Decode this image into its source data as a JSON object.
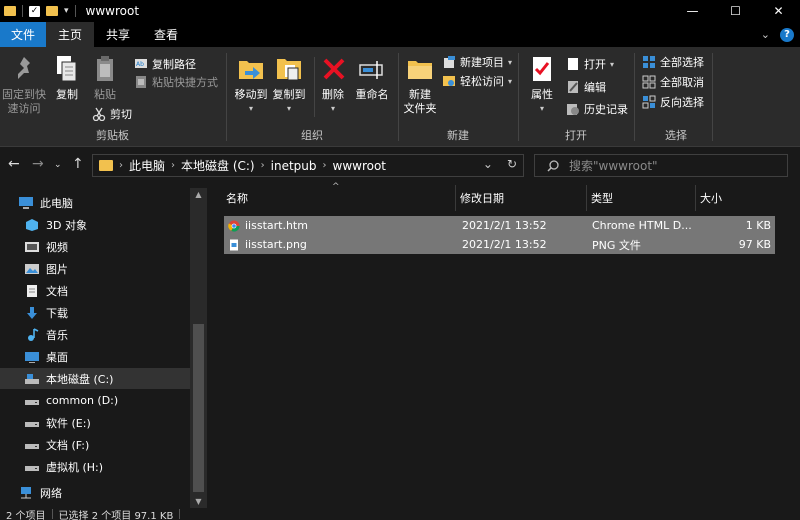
{
  "window": {
    "title": "wwwroot",
    "controls": [
      "—",
      "☐",
      "✕"
    ]
  },
  "ribbon_tabs": [
    "文件",
    "主页",
    "共享",
    "查看"
  ],
  "ribbon": {
    "clipboard": {
      "label": "剪贴板",
      "pin": "固定到快速访问",
      "pin_line1": "固定到快",
      "pin_line2": "速访问",
      "copy": "复制",
      "paste": "粘贴",
      "copy_path": "复制路径",
      "paste_shortcut": "粘贴快捷方式",
      "cut": "剪切"
    },
    "organize": {
      "label": "组织",
      "move_to": "移动到",
      "copy_to": "复制到",
      "delete": "删除",
      "rename": "重命名"
    },
    "new": {
      "label": "新建",
      "new_folder_line1": "新建",
      "new_folder_line2": "文件夹",
      "new_item": "新建项目",
      "easy_access": "轻松访问"
    },
    "open": {
      "label": "打开",
      "properties": "属性",
      "open": "打开",
      "edit": "编辑",
      "history": "历史记录"
    },
    "select": {
      "label": "选择",
      "select_all": "全部选择",
      "select_none": "全部取消",
      "invert": "反向选择"
    }
  },
  "address": {
    "crumbs": [
      "此电脑",
      "本地磁盘 (C:)",
      "inetpub",
      "wwwroot"
    ],
    "search_placeholder": "搜索\"wwwroot\""
  },
  "nav": [
    {
      "label": "此电脑",
      "icon": "computer-icon",
      "selected": false
    },
    {
      "label": "3D 对象",
      "icon": "3d-objects-icon",
      "selected": false
    },
    {
      "label": "视频",
      "icon": "videos-icon",
      "selected": false
    },
    {
      "label": "图片",
      "icon": "pictures-icon",
      "selected": false
    },
    {
      "label": "文档",
      "icon": "documents-icon",
      "selected": false
    },
    {
      "label": "下载",
      "icon": "downloads-icon",
      "selected": false
    },
    {
      "label": "音乐",
      "icon": "music-icon",
      "selected": false
    },
    {
      "label": "桌面",
      "icon": "desktop-icon",
      "selected": false
    },
    {
      "label": "本地磁盘 (C:)",
      "icon": "drive-c-icon",
      "selected": true
    },
    {
      "label": "common (D:)",
      "icon": "drive-icon",
      "selected": false
    },
    {
      "label": "软件 (E:)",
      "icon": "drive-icon",
      "selected": false
    },
    {
      "label": "文档 (F:)",
      "icon": "drive-icon",
      "selected": false
    },
    {
      "label": "虚拟机 (H:)",
      "icon": "drive-icon",
      "selected": false
    },
    {
      "label": "网络",
      "icon": "network-icon",
      "selected": false
    }
  ],
  "columns": [
    "名称",
    "修改日期",
    "类型",
    "大小"
  ],
  "files": [
    {
      "name": "iisstart.htm",
      "modified": "2021/2/1 13:52",
      "type": "Chrome HTML D...",
      "size": "1 KB",
      "icon": "chrome-html-icon"
    },
    {
      "name": "iisstart.png",
      "modified": "2021/2/1 13:52",
      "type": "PNG 文件",
      "size": "97 KB",
      "icon": "png-file-icon"
    }
  ],
  "status": {
    "count": "2 个项目",
    "selected": "已选择 2 个项目  97.1 KB"
  },
  "colors": {
    "accent": "#1979ca",
    "background": "#191919",
    "ribbon": "#2b2b2b",
    "selection": "#777777",
    "folder": "#f2c14e"
  }
}
